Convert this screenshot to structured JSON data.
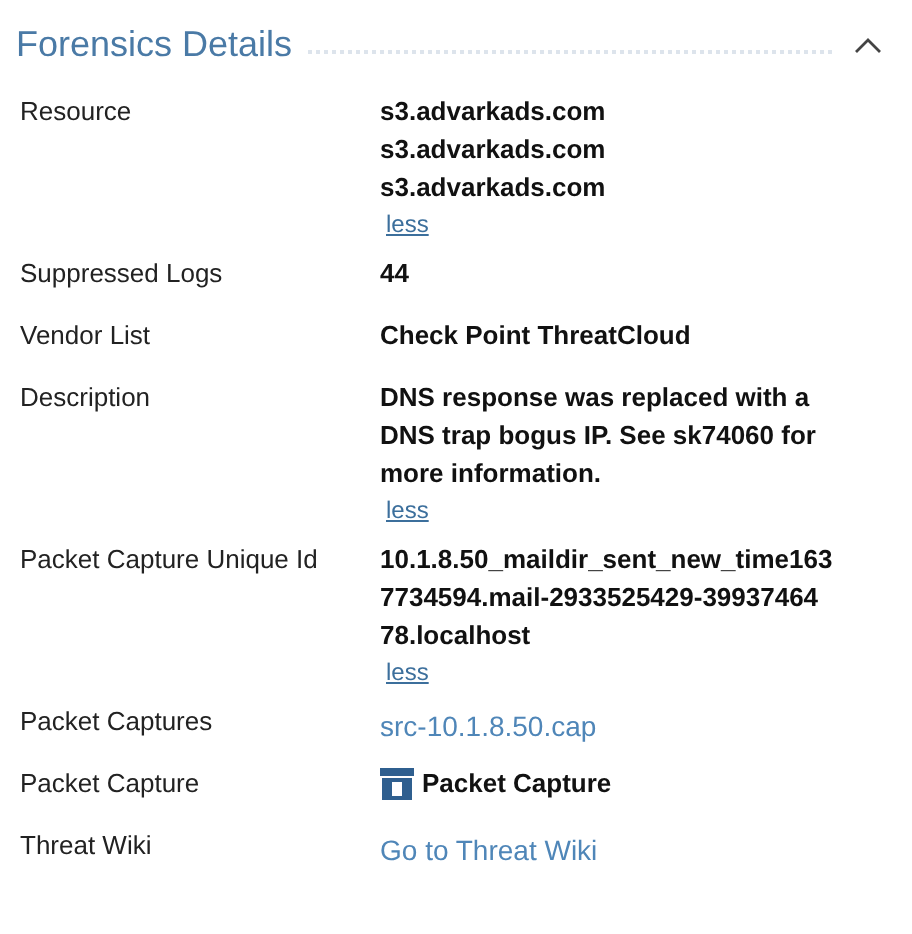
{
  "section": {
    "title": "Forensics Details",
    "expanded": true
  },
  "rows": [
    {
      "label": "Resource",
      "kind": "text",
      "lines": [
        "s3.advarkads.com",
        "s3.advarkads.com",
        "s3.advarkads.com"
      ],
      "toggle": "less"
    },
    {
      "label": "Suppressed Logs",
      "kind": "text",
      "lines": [
        "44"
      ]
    },
    {
      "label": "Vendor List",
      "kind": "text",
      "lines": [
        "Check Point ThreatCloud"
      ]
    },
    {
      "label": "Description",
      "kind": "text",
      "lines": [
        "DNS response was replaced with a",
        "DNS trap bogus IP. See sk74060 for",
        "more information."
      ],
      "toggle": "less"
    },
    {
      "label": "Packet Capture Unique Id",
      "kind": "text",
      "lines": [
        "10.1.8.50_maildir_sent_new_time163",
        "7734594.mail-2933525429-39937464",
        "78.localhost"
      ],
      "toggle": "less"
    },
    {
      "label": "Packet Captures",
      "kind": "link",
      "lines": [
        "src-10.1.8.50.cap"
      ]
    },
    {
      "label": "Packet Capture",
      "kind": "icon-text",
      "lines": [
        "Packet Capture"
      ]
    },
    {
      "label": "Threat Wiki",
      "kind": "link",
      "lines": [
        "Go to Threat Wiki"
      ]
    }
  ]
}
